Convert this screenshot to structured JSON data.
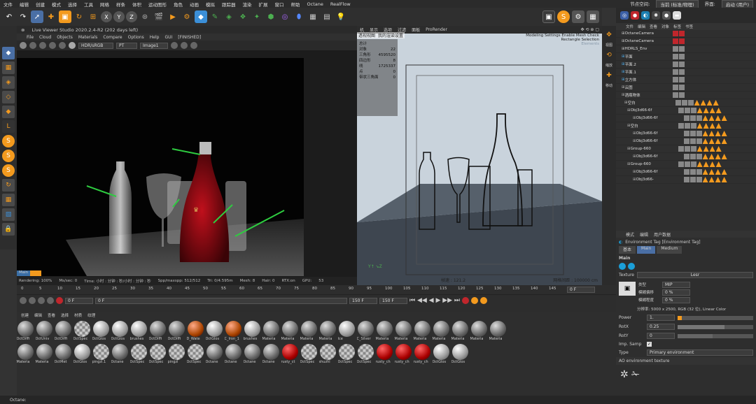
{
  "menubar": {
    "items": [
      "文件",
      "编辑",
      "创建",
      "模式",
      "选择",
      "工具",
      "网格",
      "样条",
      "体积",
      "运动图形",
      "角色",
      "动画",
      "模拟",
      "跟踪器",
      "渲染",
      "扩展",
      "窗口",
      "帮助",
      "Octane",
      "RealFlow"
    ],
    "node_space_label": "节点空间:",
    "node_space_value": "当前 (标准/物理)",
    "interface_label": "界面:",
    "interface_value": "启动 (用户)"
  },
  "live_viewer": {
    "title": "Live Viewer Studio 2020.2.4-R2 (202 days left)",
    "menu": [
      "File",
      "Cloud",
      "Objects",
      "Materials",
      "Compare",
      "Options",
      "Help",
      "GUI",
      "[FINISHED]"
    ],
    "color_mode": "HDR/sRGB",
    "pt": "PT",
    "image": "Image1",
    "tab_main": "Main",
    "status": {
      "rendering": "Rendering: 100%",
      "ms": "Ms/sec: 0",
      "time": "Time: 小时 : 分钟 : 秒/小时 : 分钟 : 秒",
      "spp": "Spp/maxspp: 512/512",
      "tri": "Tri: 0/4.595m",
      "mesh": "Mesh: 8",
      "hair": "Hair: 0",
      "rtx": "RTX:on",
      "gpu": "GPU:",
      "gpu_val": "53"
    }
  },
  "viewport": {
    "menu": [
      "机",
      "显示",
      "选项",
      "过滤",
      "面板",
      "ProRender"
    ],
    "label": "透视视图",
    "camera": "我的渲染设置",
    "top_right": "Modeling Settings Enable Mesh Check",
    "top_right2": "Rectangle Selection",
    "faded": "Elements",
    "stats": [
      [
        "总计",
        ""
      ],
      [
        "对象",
        "22"
      ],
      [
        "",
        ""
      ],
      [
        "三角形",
        "4595520"
      ],
      [
        "四边形",
        "8"
      ],
      [
        "线",
        "1725337"
      ],
      [
        "点",
        "0"
      ],
      [
        "带状三角面",
        "0"
      ]
    ],
    "speed": "帧速 : 121.2",
    "grid": "网格间距 : 100000 cm"
  },
  "vside": [
    "视图",
    "缩放",
    "移动"
  ],
  "object_manager": {
    "menu": [
      "文件",
      "编辑",
      "查看",
      "对象",
      "标签",
      "书签"
    ],
    "objects": [
      "OctaneCamera",
      "OctaneCamera",
      "HDRLS_Env",
      "平面",
      "平面.2",
      "平面.1",
      "立方体",
      "云图",
      "酒瓶物体",
      "空白",
      "Obj3d66-6f",
      "Obj3d66-6f",
      "空白",
      "Obj3d66-6f",
      "Obj3d66-6f",
      "Group-660",
      "Obj3d66-6f",
      "Group-660",
      "Obj3d66-6f",
      "Obj3d66-"
    ]
  },
  "attributes": {
    "menu": [
      "模式",
      "编辑",
      "用户数据"
    ],
    "title": "Environment Tag [Environment Tag]",
    "tabs": [
      "基本",
      "Main",
      "Medium"
    ],
    "section": "Main",
    "texture_label": "Texture",
    "texture_value": "Lesr",
    "imgtype_label": "类型",
    "imgtype_value": "MIP",
    "offset_x_label": "模糊偏移",
    "offset_x_value": "0 %",
    "offset_y_label": "模糊程度",
    "offset_y_value": "0 %",
    "resolution": "分辨率: 5000 x 2500, RGB (32 位), Linear Color",
    "power_label": "Power",
    "power_value": "1.",
    "rotx_label": "RotX",
    "rotx_value": "0.25",
    "roty_label": "RotY",
    "roty_value": "0",
    "impsamp_label": "Imp. Samp",
    "type_label": "Type",
    "type_value": "Primary environment",
    "ao_label": "AO environment texture"
  },
  "timeline": {
    "ticks": [
      "0",
      "5",
      "10",
      "15",
      "20",
      "25",
      "30",
      "35",
      "40",
      "45",
      "50",
      "55",
      "60",
      "65",
      "70",
      "75",
      "80",
      "85",
      "90",
      "95",
      "100",
      "105",
      "110",
      "115",
      "120",
      "125",
      "130",
      "135",
      "140",
      "145",
      "150"
    ],
    "frame_field": "0 F",
    "start": "0 F",
    "field2": "0 F",
    "end": "150 F",
    "end2": "150 F",
    "right_field": "0 F"
  },
  "materials": {
    "menu": [
      "创建",
      "编辑",
      "查看",
      "选择",
      "材质",
      "纹理"
    ],
    "row1": [
      "OctDiffi",
      "OctUniv",
      "OctDiffi",
      "OctSpec",
      "OctGlos",
      "OctGlos",
      "brushes",
      "OctDiffi",
      "OctDiffi",
      "D_Wate",
      "OctGlos",
      "C_Iron_1",
      "brushes",
      "Materia",
      "Materia",
      "Materia",
      "Materia",
      "Ice",
      "C_Silver",
      "Materia",
      "Materia",
      "Materia",
      "Materia",
      "Materia",
      "Materia",
      "Materia"
    ],
    "row2": [
      "Materia",
      "Materia",
      "OctMet",
      "OctGlos",
      "pingzi.1",
      "Octane",
      "OctSpec",
      "OctSpec",
      "pingzi",
      "OctSpec",
      "Octane",
      "Octane",
      "Octane",
      "Octane",
      "rusty_ct",
      "OctSpec",
      "shuzhi",
      "OctSpec",
      "OctSpec",
      "rusty_ch",
      "rusty_ch",
      "rusty_ch",
      "OctGlos",
      "OctGlos"
    ]
  },
  "statusbar": {
    "text": "Octane:"
  }
}
